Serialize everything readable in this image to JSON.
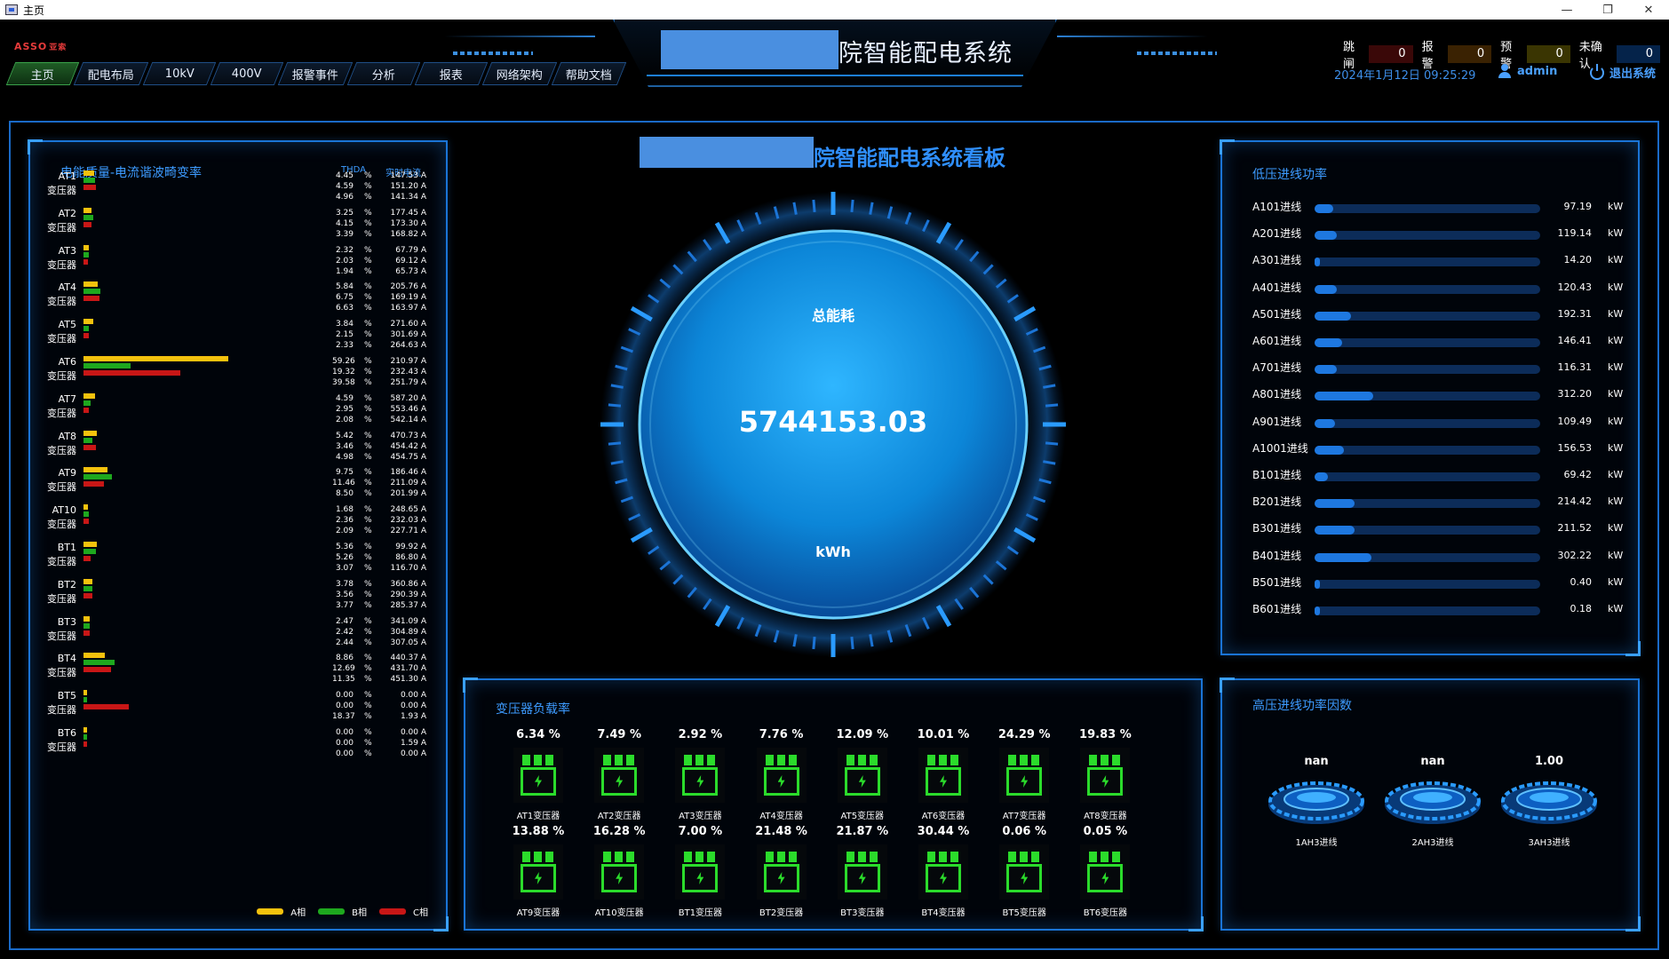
{
  "window": {
    "title": "主页"
  },
  "header": {
    "brand": "ASSO",
    "brand_sub": "亚索",
    "system_title": "院智能配电系统",
    "nav": [
      {
        "label": "主页",
        "active": true
      },
      {
        "label": "配电布局"
      },
      {
        "label": "10kV"
      },
      {
        "label": "400V"
      },
      {
        "label": "报警事件"
      },
      {
        "label": "分析"
      },
      {
        "label": "报表"
      },
      {
        "label": "网络架构"
      },
      {
        "label": "帮助文档"
      }
    ],
    "alarms": [
      {
        "label": "跳闸",
        "value": "0",
        "color": "#3a0808"
      },
      {
        "label": "报警",
        "value": "0",
        "color": "#3a2202"
      },
      {
        "label": "预警",
        "value": "0",
        "color": "#3a3502"
      },
      {
        "label": "未确认",
        "value": "0",
        "color": "#05234a"
      }
    ],
    "datetime": "2024年1月12日 09:25:29",
    "user": "admin",
    "logout": "退出系统"
  },
  "harmonics": {
    "title": "电能质量-电流谐波畸变率",
    "col_thda": "THDA",
    "col_current": "实时电流",
    "suffix": "变压器",
    "pct_sign": "%",
    "legend": {
      "a": "A相",
      "b": "B相",
      "c": "C相"
    },
    "colors": {
      "a": "#f4c20d",
      "b": "#1ea81e",
      "c": "#c81616"
    },
    "rows": [
      {
        "name": "AT1",
        "thd": [
          "4.45",
          "4.59",
          "4.96"
        ],
        "cur": [
          "147.53 A",
          "151.20 A",
          "141.34 A"
        ]
      },
      {
        "name": "AT2",
        "thd": [
          "3.25",
          "4.15",
          "3.39"
        ],
        "cur": [
          "177.45 A",
          "173.30 A",
          "168.82 A"
        ]
      },
      {
        "name": "AT3",
        "thd": [
          "2.32",
          "2.03",
          "1.94"
        ],
        "cur": [
          "67.79 A",
          "69.12 A",
          "65.73 A"
        ]
      },
      {
        "name": "AT4",
        "thd": [
          "5.84",
          "6.75",
          "6.63"
        ],
        "cur": [
          "205.76 A",
          "169.19 A",
          "163.97 A"
        ]
      },
      {
        "name": "AT5",
        "thd": [
          "3.84",
          "2.15",
          "2.33"
        ],
        "cur": [
          "271.60 A",
          "301.69 A",
          "264.63 A"
        ]
      },
      {
        "name": "AT6",
        "thd": [
          "59.26",
          "19.32",
          "39.58"
        ],
        "cur": [
          "210.97 A",
          "232.43 A",
          "251.79 A"
        ]
      },
      {
        "name": "AT7",
        "thd": [
          "4.59",
          "2.95",
          "2.08"
        ],
        "cur": [
          "587.20 A",
          "553.46 A",
          "542.14 A"
        ]
      },
      {
        "name": "AT8",
        "thd": [
          "5.42",
          "3.46",
          "4.98"
        ],
        "cur": [
          "470.73 A",
          "454.42 A",
          "454.75 A"
        ]
      },
      {
        "name": "AT9",
        "thd": [
          "9.75",
          "11.46",
          "8.50"
        ],
        "cur": [
          "186.46 A",
          "211.09 A",
          "201.99 A"
        ]
      },
      {
        "name": "AT10",
        "thd": [
          "1.68",
          "2.36",
          "2.09"
        ],
        "cur": [
          "248.65 A",
          "232.03 A",
          "227.71 A"
        ]
      },
      {
        "name": "BT1",
        "thd": [
          "5.36",
          "5.26",
          "3.07"
        ],
        "cur": [
          "99.92 A",
          "86.80 A",
          "116.70 A"
        ]
      },
      {
        "name": "BT2",
        "thd": [
          "3.78",
          "3.56",
          "3.77"
        ],
        "cur": [
          "360.86 A",
          "290.39 A",
          "285.37 A"
        ]
      },
      {
        "name": "BT3",
        "thd": [
          "2.47",
          "2.42",
          "2.44"
        ],
        "cur": [
          "341.09 A",
          "304.89 A",
          "307.05 A"
        ]
      },
      {
        "name": "BT4",
        "thd": [
          "8.86",
          "12.69",
          "11.35"
        ],
        "cur": [
          "440.37 A",
          "431.70 A",
          "451.30 A"
        ]
      },
      {
        "name": "BT5",
        "thd": [
          "0.00",
          "0.00",
          "18.37"
        ],
        "cur": [
          "0.00 A",
          "0.00 A",
          "1.93 A"
        ]
      },
      {
        "name": "BT6",
        "thd": [
          "0.00",
          "0.00",
          "0.00"
        ],
        "cur": [
          "0.00 A",
          "1.59 A",
          "0.00 A"
        ]
      }
    ]
  },
  "board": {
    "title": "院智能配电系统看板",
    "energy_label": "总能耗",
    "energy_value": "5744153.03",
    "energy_unit": "kWh"
  },
  "low_power": {
    "title": "低压进线功率",
    "unit": "kW",
    "max": 1200,
    "rows": [
      {
        "name": "A101进线",
        "value": "97.19"
      },
      {
        "name": "A201进线",
        "value": "119.14"
      },
      {
        "name": "A301进线",
        "value": "14.20"
      },
      {
        "name": "A401进线",
        "value": "120.43"
      },
      {
        "name": "A501进线",
        "value": "192.31"
      },
      {
        "name": "A601进线",
        "value": "146.41"
      },
      {
        "name": "A701进线",
        "value": "116.31"
      },
      {
        "name": "A801进线",
        "value": "312.20"
      },
      {
        "name": "A901进线",
        "value": "109.49"
      },
      {
        "name": "A1001进线",
        "value": "156.53"
      },
      {
        "name": "B101进线",
        "value": "69.42"
      },
      {
        "name": "B201进线",
        "value": "214.42"
      },
      {
        "name": "B301进线",
        "value": "211.52"
      },
      {
        "name": "B401进线",
        "value": "302.22"
      },
      {
        "name": "B501进线",
        "value": "0.40"
      },
      {
        "name": "B601进线",
        "value": "0.18"
      }
    ]
  },
  "transformers": {
    "title": "变压器负载率",
    "items": [
      {
        "name": "AT1变压器",
        "load": "6.34 %"
      },
      {
        "name": "AT2变压器",
        "load": "7.49 %"
      },
      {
        "name": "AT3变压器",
        "load": "2.92 %"
      },
      {
        "name": "AT4变压器",
        "load": "7.76 %"
      },
      {
        "name": "AT5变压器",
        "load": "12.09 %"
      },
      {
        "name": "AT6变压器",
        "load": "10.01 %"
      },
      {
        "name": "AT7变压器",
        "load": "24.29 %"
      },
      {
        "name": "AT8变压器",
        "load": "19.83 %"
      },
      {
        "name": "AT9变压器",
        "load": "13.88 %"
      },
      {
        "name": "AT10变压器",
        "load": "16.28 %"
      },
      {
        "name": "BT1变压器",
        "load": "7.00 %"
      },
      {
        "name": "BT2变压器",
        "load": "21.48 %"
      },
      {
        "name": "BT3变压器",
        "load": "21.87 %"
      },
      {
        "name": "BT4变压器",
        "load": "30.44 %"
      },
      {
        "name": "BT5变压器",
        "load": "0.06 %"
      },
      {
        "name": "BT6变压器",
        "load": "0.05 %"
      }
    ]
  },
  "high_voltage": {
    "title": "高压进线功率因数",
    "items": [
      {
        "name": "1AH3进线",
        "value": "nan"
      },
      {
        "name": "2AH3进线",
        "value": "nan"
      },
      {
        "name": "3AH3进线",
        "value": "1.00"
      }
    ]
  }
}
